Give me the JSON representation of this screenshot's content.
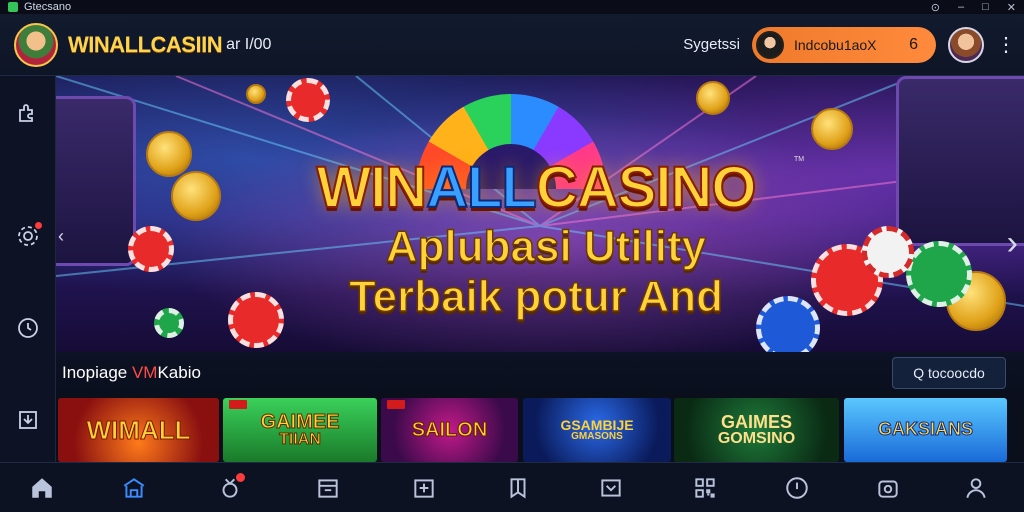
{
  "window": {
    "title": "Gtecsano",
    "controls": [
      "⊙",
      "–",
      "□",
      "✕"
    ]
  },
  "header": {
    "brand": "WINALLCASIIN",
    "brand_suffix": "ar I/00",
    "search_label": "Sygetssi",
    "pill_text": "Indcobu1aoX",
    "pill_count": "6",
    "menu": "⋮"
  },
  "banner": {
    "title_part1": "WIN",
    "title_part2": "ALL",
    "title_part3": "CASINO",
    "tm": "TM",
    "line1": "Aplubasi Utility",
    "line2": "Terbaik potur And",
    "prev": "‹",
    "next": "›"
  },
  "section": {
    "title": "Inopiage ",
    "title_accent": "VM",
    "title_rest": "Kabio",
    "button_label": "Q tocoocdo"
  },
  "games": [
    {
      "label": "WIMALL",
      "sub": ""
    },
    {
      "label": "GAIMEE",
      "sub": "TIIAN"
    },
    {
      "label": "SAILON",
      "sub": ""
    },
    {
      "label": "GSAMBIJE",
      "sub": "GMASONS"
    },
    {
      "label": "GAIMES",
      "sub": "GOMSINO"
    },
    {
      "label": "GAKSIANS",
      "sub": ""
    }
  ],
  "colors": {
    "accent": "#3a8cff",
    "pill": "#f07a2a",
    "badge": "#ff3b3b",
    "brand_gold": "#ffd34d"
  },
  "sidebar_icons": [
    "puzzle-icon",
    "gear-icon",
    "clock-icon",
    "download-icon"
  ],
  "nav_icons": [
    "home-icon",
    "lobby-icon",
    "promo-icon",
    "calendar-icon",
    "inbox-icon",
    "bookmark-icon",
    "chat-icon",
    "qr-icon",
    "clock-icon",
    "wallet-icon",
    "profile-icon"
  ]
}
